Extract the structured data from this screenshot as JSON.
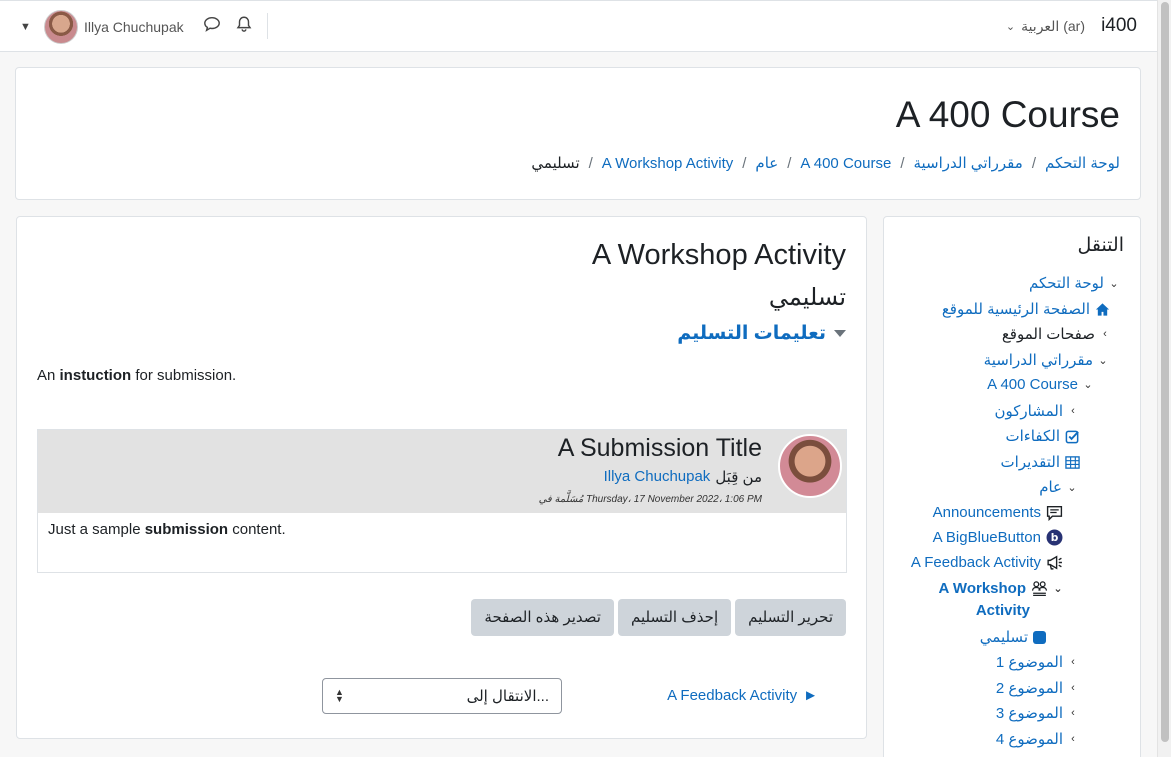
{
  "navbar": {
    "brand": "i400",
    "language": "العربية (ar)",
    "user_name": "Illya Chuchupak"
  },
  "header": {
    "title": "A 400 Course",
    "breadcrumb": [
      "لوحة التحكم",
      "مقرراتي الدراسية",
      "A 400 Course",
      "عام",
      "A Workshop Activity",
      "تسليمي"
    ]
  },
  "main": {
    "activity_title": "A Workshop Activity",
    "page_subtitle": "تسليمي",
    "instructions_toggle": "تعليمات التسليم",
    "instruction_prefix": "An ",
    "instruction_bold": "instuction",
    "instruction_suffix": " for submission.",
    "submission": {
      "title": "A Submission Title",
      "by_label": "من قِبَل",
      "author": "Illya Chuchupak",
      "submitted_date": "مُسَلَّمة في Thursday، 17 November 2022، 1:06 PM",
      "content_prefix": "Just a sample ",
      "content_bold": "submission",
      "content_suffix": " content."
    },
    "buttons": {
      "edit": "تحرير التسليم",
      "delete": "إحذف التسليم",
      "export": "تصدير هذه الصفحة"
    },
    "next_activity": "A Feedback Activity",
    "next_arrow": "►",
    "jump_placeholder": "الانتقال إلى..."
  },
  "navigation": {
    "title": "التنقل",
    "items": [
      {
        "label": "لوحة التحكم"
      },
      {
        "label": "الصفحة الرئيسية للموقع"
      },
      {
        "label": "صفحات الموقع"
      },
      {
        "label": "مقرراتي الدراسية"
      },
      {
        "label": "A 400 Course"
      },
      {
        "label": "المشاركون"
      },
      {
        "label": "الكفاءات"
      },
      {
        "label": "التقديرات"
      },
      {
        "label": "عام"
      },
      {
        "label": "Announcements"
      },
      {
        "label": "A BigBlueButton"
      },
      {
        "label": "A Feedback Activity"
      },
      {
        "label": "A Workshop"
      },
      {
        "label": "Activity"
      },
      {
        "label": "تسليمي"
      },
      {
        "label": "الموضوع 1"
      },
      {
        "label": "الموضوع 2"
      },
      {
        "label": "الموضوع 3"
      },
      {
        "label": "الموضوع 4"
      }
    ]
  },
  "colors": {
    "link": "#0f6cbf",
    "button_bg": "#ced4da",
    "submission_header_bg": "#e2e2e2"
  }
}
